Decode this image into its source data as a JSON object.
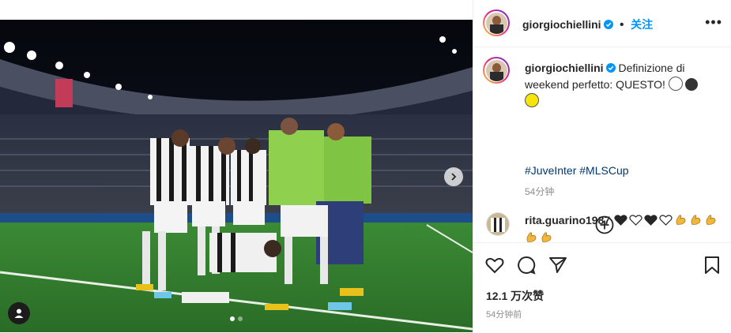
{
  "post": {
    "author": "giorgiochiellini",
    "follow_label": "关注",
    "more_label": "•••",
    "caption_text": "Definizione di weekend perfetto: QUESTO!",
    "hashtags": [
      "#JuveInter",
      "#MLSCup"
    ],
    "caption_time": "54分钟",
    "likes_label": "12.1 万次赞",
    "post_time": "54分钟前"
  },
  "comment": {
    "author": "rita.guarino1987",
    "hearts": [
      "black",
      "white",
      "black",
      "white"
    ],
    "muscles": 5
  },
  "carousel": {
    "slides": 2,
    "active_index": 0
  },
  "colors": {
    "link": "#00376b",
    "follow": "#0095f6",
    "verified": "#0095f6",
    "muted": "#8e8e8e",
    "bib": "#8fd14f",
    "pitch": "#2f7f2e"
  },
  "icons": {
    "like": "heart-outline-icon",
    "comment": "speech-bubble-icon",
    "share": "paper-plane-icon",
    "save": "bookmark-icon",
    "more": "ellipsis-icon",
    "add_comment": "plus-circle-icon",
    "tagged_users": "user-icon",
    "next": "chevron-right-icon"
  }
}
